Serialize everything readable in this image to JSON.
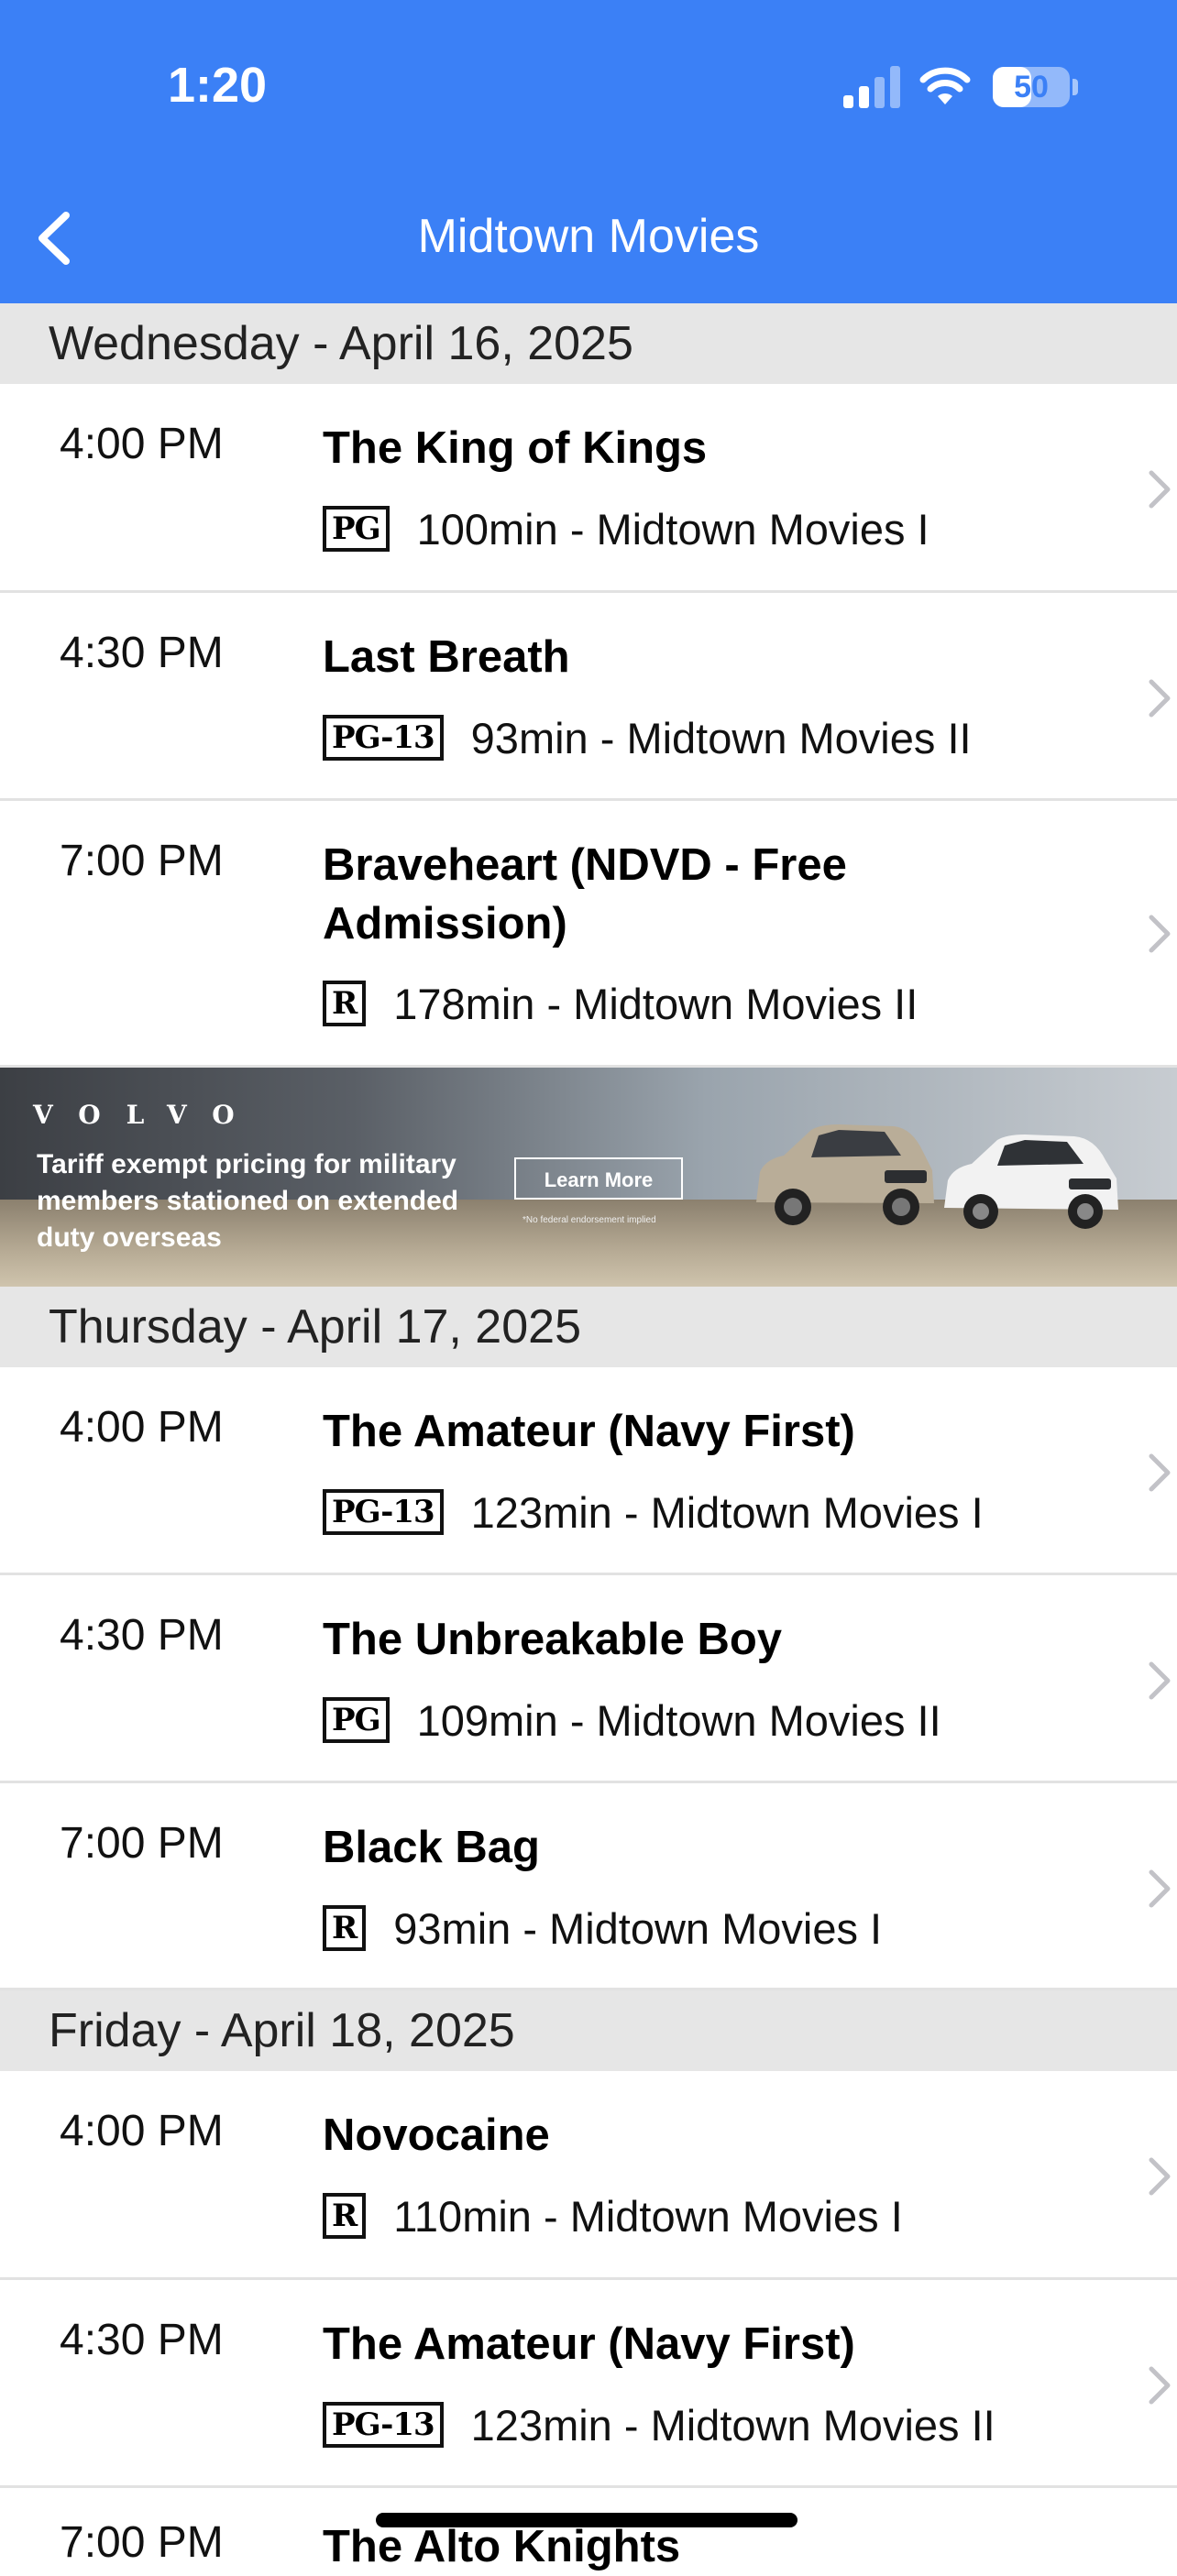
{
  "status_bar": {
    "time": "1:20",
    "battery": "50"
  },
  "nav": {
    "title": "Midtown Movies",
    "back_icon": "chevron-left-icon"
  },
  "sections": [
    {
      "date": "Wednesday - April 16, 2025",
      "showings": [
        {
          "time": "4:00 PM",
          "title": "The King of Kings",
          "rating": "PG",
          "details": "100min - Midtown Movies I"
        },
        {
          "time": "4:30 PM",
          "title": "Last Breath",
          "rating": "PG-13",
          "details": "93min - Midtown Movies II"
        },
        {
          "time": "7:00 PM",
          "title": "Braveheart (NDVD - Free Admission)",
          "rating": "R",
          "details": "178min - Midtown Movies II"
        }
      ]
    },
    {
      "date": "Thursday - April 17, 2025",
      "showings": [
        {
          "time": "4:00 PM",
          "title": "The Amateur (Navy First)",
          "rating": "PG-13",
          "details": "123min - Midtown Movies I"
        },
        {
          "time": "4:30 PM",
          "title": "The Unbreakable Boy",
          "rating": "PG",
          "details": "109min - Midtown Movies II"
        },
        {
          "time": "7:00 PM",
          "title": "Black Bag",
          "rating": "R",
          "details": "93min - Midtown Movies I"
        }
      ]
    },
    {
      "date": "Friday - April 18, 2025",
      "showings": [
        {
          "time": "4:00 PM",
          "title": "Novocaine",
          "rating": "R",
          "details": "110min - Midtown Movies I"
        },
        {
          "time": "4:30 PM",
          "title": "The Amateur (Navy First)",
          "rating": "PG-13",
          "details": "123min - Midtown Movies II"
        },
        {
          "time": "7:00 PM",
          "title": "The Alto Knights",
          "rating": "",
          "details": ""
        }
      ]
    }
  ],
  "ad": {
    "brand": "VOLVO",
    "text": "Tariff exempt pricing for military members stationed on extended duty overseas",
    "cta": "Learn More",
    "fine_print": "*No federal endorsement implied"
  },
  "colors": {
    "header": "#3b80f6",
    "section_bg": "#e6e6e6"
  }
}
